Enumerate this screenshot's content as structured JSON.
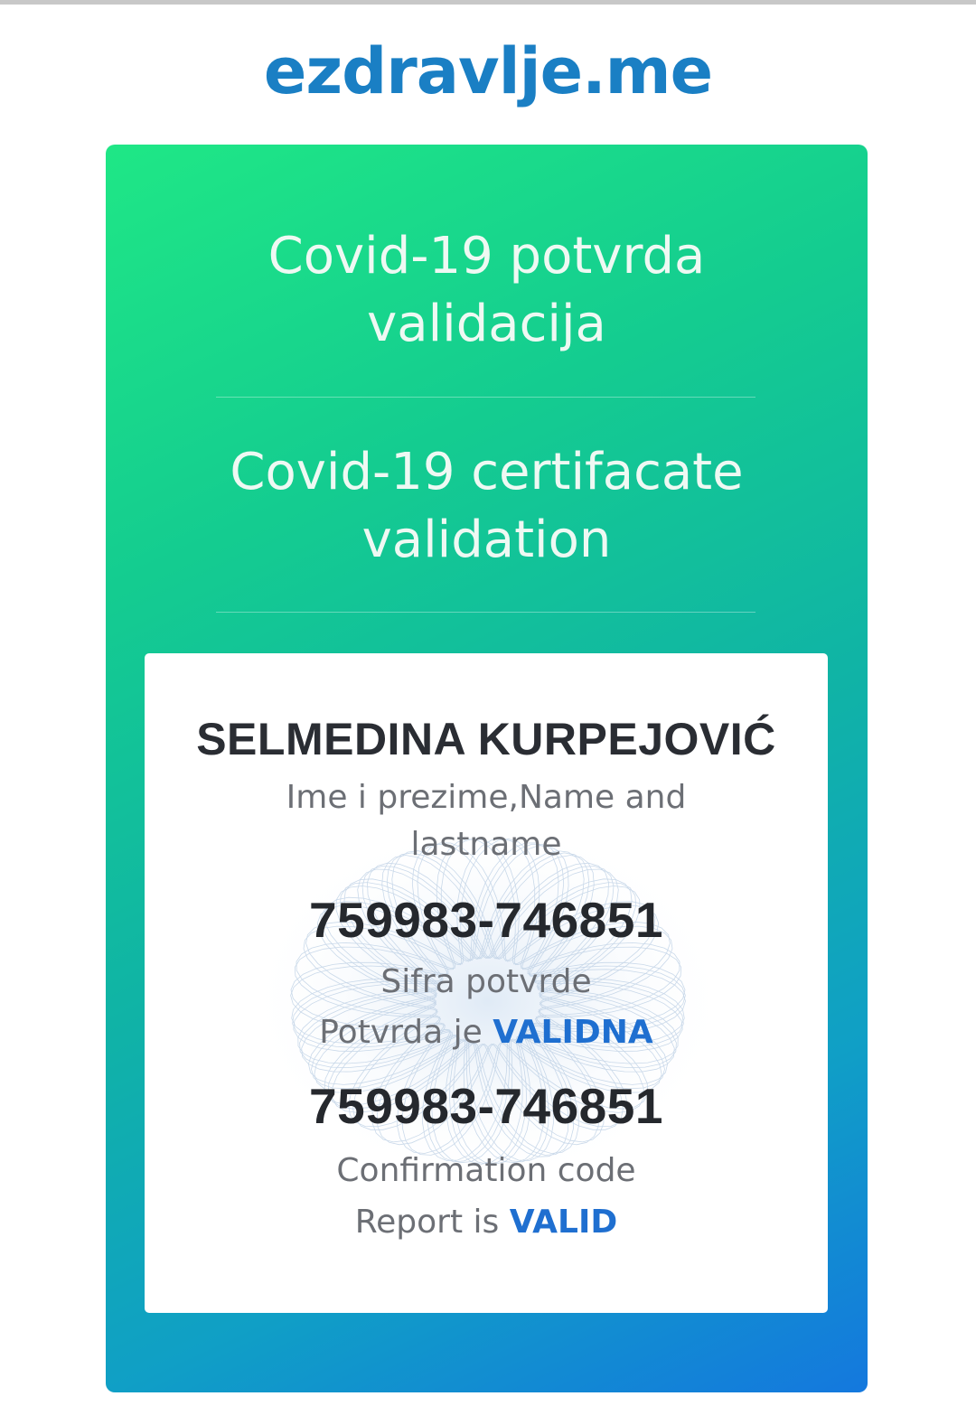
{
  "header": {
    "site_name": "ezdravlje.me"
  },
  "card": {
    "heading_sr": {
      "line1": "Covid-19 potvrda",
      "line2": "validacija"
    },
    "heading_en": {
      "line1": "Covid-19 certifacate",
      "line2": "validation"
    }
  },
  "result": {
    "holder_name": "SELMEDINA KURPEJOVIĆ",
    "name_label": {
      "line1": "Ime i prezime,Name and",
      "line2": "lastname"
    },
    "code_sr": "759983-746851",
    "code_label_sr": "Sifra potvrde",
    "status_sr": {
      "prefix": "Potvrda je ",
      "value": "VALIDNA"
    },
    "code_en": "759983-746851",
    "code_label_en": "Confirmation code",
    "status_en": {
      "prefix": "Report is ",
      "value": "VALID"
    }
  },
  "colors": {
    "brand": "#1a7fc4",
    "gradient_start": "#1fe786",
    "gradient_end": "#1478de",
    "valid_accent": "#1f6fd0"
  }
}
